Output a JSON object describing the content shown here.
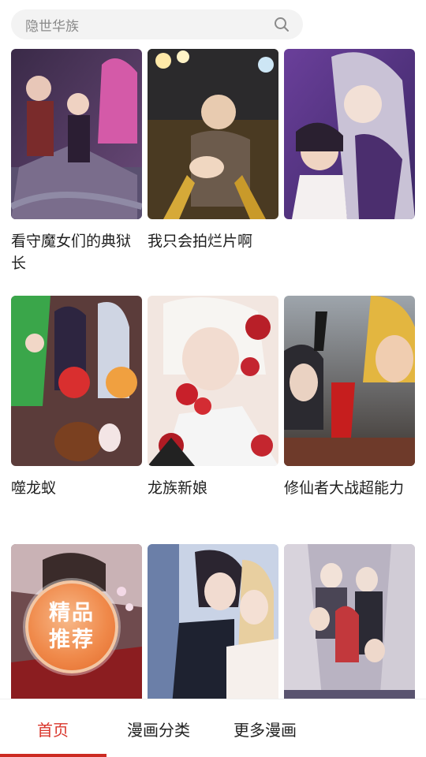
{
  "search": {
    "placeholder": "隐世华族"
  },
  "comics": [
    {
      "title": "看守魔女们的典狱长"
    },
    {
      "title": "我只会拍烂片啊"
    },
    {
      "title": ""
    },
    {
      "title": "噬龙蚁"
    },
    {
      "title": "龙族新娘"
    },
    {
      "title": "修仙者大战超能力"
    },
    {
      "title": ""
    },
    {
      "title": ""
    },
    {
      "title": ""
    }
  ],
  "badge": {
    "line1": "精品",
    "line2": "推荐"
  },
  "nav": {
    "items": [
      {
        "label": "首页",
        "active": true
      },
      {
        "label": "漫画分类",
        "active": false
      },
      {
        "label": "更多漫画",
        "active": false
      }
    ]
  },
  "colors": {
    "accent": "#d9352b",
    "search_bg": "#f3f3f3"
  }
}
